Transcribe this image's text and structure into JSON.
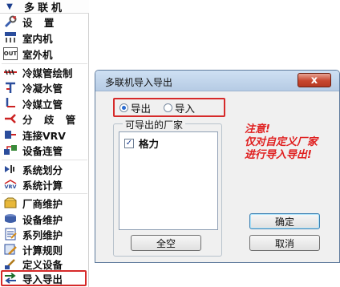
{
  "menu": {
    "header_label": "多联机",
    "header_icon": "chevron-down-icon",
    "items": [
      {
        "label": "设 置",
        "icon": "settings-icon"
      },
      {
        "label": "室内机",
        "icon": "indoor-unit-icon"
      },
      {
        "label": "室外机",
        "icon": "outdoor-unit-icon"
      },
      {
        "label": "冷媒管绘制",
        "icon": "refrigerant-pipe-icon"
      },
      {
        "label": "冷凝水管",
        "icon": "condensate-pipe-icon"
      },
      {
        "label": "冷媒立管",
        "icon": "riser-pipe-icon"
      },
      {
        "label": "分 歧 管",
        "icon": "branch-pipe-icon"
      },
      {
        "label": "连接VRV",
        "icon": "connect-vrv-icon"
      },
      {
        "label": "设备连管",
        "icon": "equipment-pipe-icon"
      },
      {
        "label": "系统划分",
        "icon": "system-divide-icon"
      },
      {
        "label": "系统计算",
        "icon": "system-calc-icon"
      },
      {
        "label": "厂商维护",
        "icon": "vendor-maintain-icon"
      },
      {
        "label": "设备维护",
        "icon": "equipment-maintain-icon"
      },
      {
        "label": "系列维护",
        "icon": "series-maintain-icon"
      },
      {
        "label": "计算规则",
        "icon": "calc-rule-icon"
      },
      {
        "label": "定义设备",
        "icon": "define-equipment-icon"
      },
      {
        "label": "导入导出",
        "icon": "import-export-icon"
      }
    ],
    "icon_text": {
      "vrv": "VRV",
      "out": "OUT"
    }
  },
  "dialog": {
    "title": "多联机导入导出",
    "close_glyph": "x",
    "radio_export": "导出",
    "radio_import": "导入",
    "group_title": "可导出的厂家",
    "list_items": [
      {
        "label": "格力",
        "checked": true
      }
    ],
    "check_glyph": "✓",
    "select_all": "全空",
    "ok": "确定",
    "cancel": "取消",
    "note_lines": [
      "注意!",
      "仅对自定义厂家",
      "进行导入导出!"
    ]
  },
  "colors": {
    "highlight_red": "#d62a2a",
    "note_red": "#e02020"
  }
}
